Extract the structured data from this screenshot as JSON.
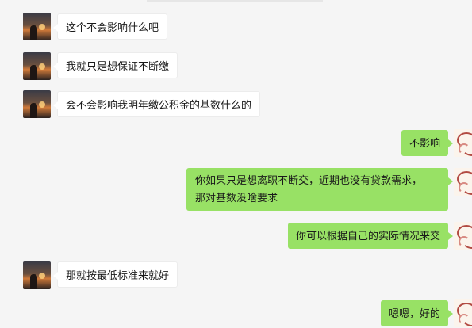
{
  "messages": [
    {
      "side": "left",
      "text": "这个不会影响什么吧"
    },
    {
      "side": "left",
      "text": "我就只是想保证不断缴"
    },
    {
      "side": "left",
      "text": "会不会影响我明年缴公积金的基数什么的"
    },
    {
      "side": "right",
      "text": "不影响"
    },
    {
      "side": "right",
      "lines": [
        "你如果只是想离职不断交，近期也没有贷款需求，",
        "那对基数没啥要求"
      ]
    },
    {
      "side": "right",
      "text": "你可以根据自己的实际情况来交"
    },
    {
      "side": "left",
      "text": "那就按最低标准来就好"
    },
    {
      "side": "right",
      "text": "嗯嗯，好的"
    }
  ],
  "colors": {
    "background": "#f5f5f5",
    "bubble_left": "#ffffff",
    "bubble_right": "#98e165"
  }
}
